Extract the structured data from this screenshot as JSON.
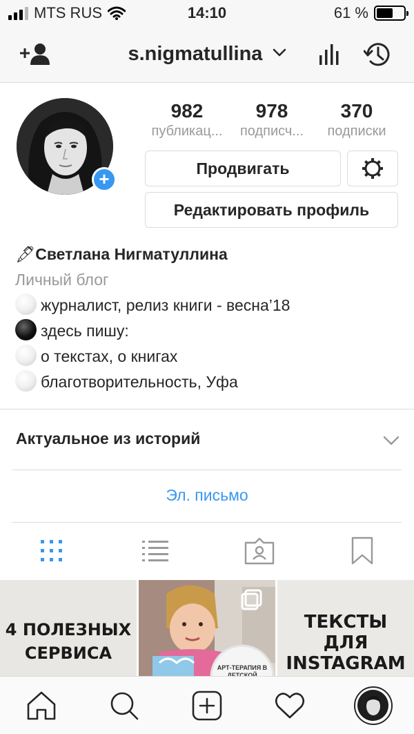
{
  "status_bar": {
    "carrier": "MTS RUS",
    "time": "14:10",
    "battery": "61 %",
    "battery_level": 0.61
  },
  "header": {
    "username": "s.nigmatullina",
    "icons": [
      "add-user-icon",
      "chevron-down-icon",
      "insights-icon",
      "archive-icon"
    ]
  },
  "profile": {
    "stats": [
      {
        "value": "982",
        "label": "публикац..."
      },
      {
        "value": "978",
        "label": "подписч..."
      },
      {
        "value": "370",
        "label": "подписки"
      }
    ],
    "promote_label": "Продвигать",
    "edit_label": "Редактировать профиль",
    "add_badge": "+"
  },
  "bio": {
    "name_emoji": "🖋",
    "name": "Светлана Нигматуллина",
    "category": "Личный блог",
    "lines": [
      {
        "dot": "white",
        "text": "журналист, релиз книги - весна’18"
      },
      {
        "dot": "black",
        "text": "здесь пишу:"
      },
      {
        "dot": "white",
        "text": "о текстах, о книгах"
      },
      {
        "dot": "white",
        "text": "благотворительность, Уфа"
      }
    ]
  },
  "highlights": {
    "label": "Актуальное из историй"
  },
  "contact": {
    "email_label": "Эл. письмо"
  },
  "tabs": [
    "grid-icon",
    "list-icon",
    "tagged-icon",
    "saved-icon"
  ],
  "posts": [
    {
      "text_line1": "4 ПОЛЕЗНЫХ",
      "text_line2": "СЕРВИСА"
    },
    {
      "caption": "АРТ-ТЕРАПИЯ В ДЕТСКОЙ"
    },
    {
      "text_line1": "ТЕКСТЫ",
      "text_line2": "ДЛЯ",
      "text_line3": "INSTAGRAM"
    }
  ],
  "tabbar": [
    "home-icon",
    "search-icon",
    "new-post-icon",
    "activity-icon",
    "profile-avatar"
  ],
  "colors": {
    "accent": "#3897f0",
    "muted": "#999999",
    "text": "#262626",
    "border": "#dbdbdb"
  }
}
